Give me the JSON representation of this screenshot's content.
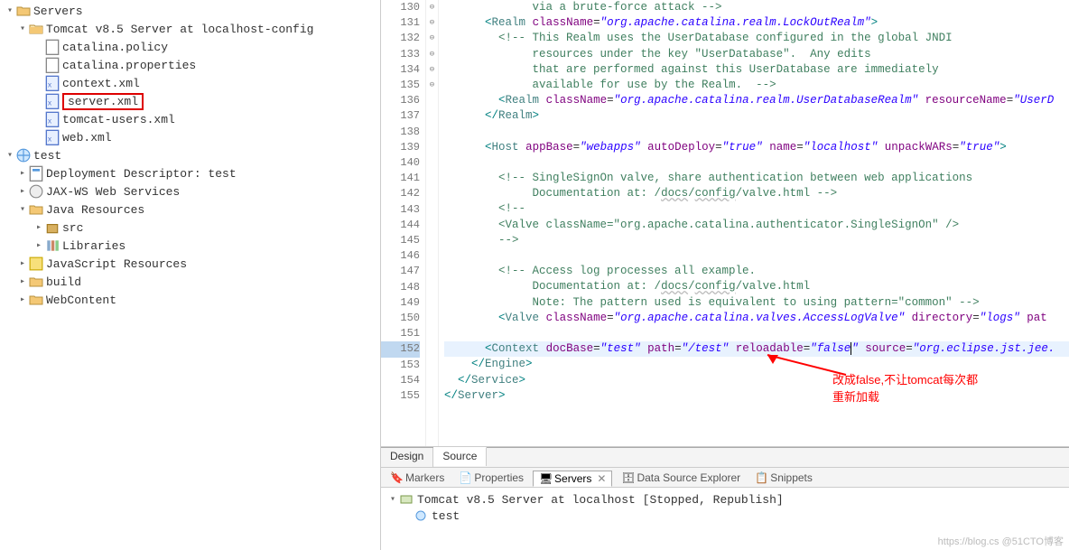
{
  "tree": {
    "servers": "Servers",
    "tomcat_config": "Tomcat v8.5 Server at localhost-config",
    "catalina_policy": "catalina.policy",
    "catalina_properties": "catalina.properties",
    "context_xml": "context.xml",
    "server_xml": "server.xml",
    "tomcat_users_xml": "tomcat-users.xml",
    "web_xml": "web.xml",
    "test": "test",
    "deployment_descriptor": "Deployment Descriptor: test",
    "jaxws": "JAX-WS Web Services",
    "java_resources": "Java Resources",
    "src": "src",
    "libraries": "Libraries",
    "js_resources": "JavaScript Resources",
    "build": "build",
    "webcontent": "WebContent"
  },
  "code": {
    "lines": [
      {
        "n": 130,
        "fold": "",
        "html": "             via a brute-force attack --&gt;",
        "cls": "c-comment"
      },
      {
        "n": 131,
        "fold": "⊖",
        "html": "      <span class='c-punct'>&lt;</span><span class='c-tag'>Realm</span> <span class='c-attr'>className</span>=<span class='c-val-str'>\"org.apache.catalina.realm.LockOutRealm\"</span><span class='c-punct'>&gt;</span>"
      },
      {
        "n": 132,
        "fold": "⊖",
        "html": "        <span class='c-comment'>&lt;!-- This Realm uses the UserDatabase configured in the global JNDI</span>"
      },
      {
        "n": 133,
        "fold": "",
        "html": "             <span class='c-comment'>resources under the key \"UserDatabase\".  Any edits</span>"
      },
      {
        "n": 134,
        "fold": "",
        "html": "             <span class='c-comment'>that are performed against this UserDatabase are immediately</span>"
      },
      {
        "n": 135,
        "fold": "",
        "html": "             <span class='c-comment'>available for use by the Realm.  --&gt;</span>"
      },
      {
        "n": 136,
        "fold": "",
        "html": "        <span class='c-punct'>&lt;</span><span class='c-tag'>Realm</span> <span class='c-attr'>className</span>=<span class='c-val-str'>\"org.apache.catalina.realm.UserDatabaseRealm\"</span> <span class='c-attr'>resourceName</span>=<span class='c-val-str'>\"UserD</span>"
      },
      {
        "n": 137,
        "fold": "",
        "html": "      <span class='c-punct'>&lt;/</span><span class='c-tag'>Realm</span><span class='c-punct'>&gt;</span>"
      },
      {
        "n": 138,
        "fold": "",
        "html": ""
      },
      {
        "n": 139,
        "fold": "⊖",
        "html": "      <span class='c-punct'>&lt;</span><span class='c-tag'>Host</span> <span class='c-attr'>appBase</span>=<span class='c-val-str'>\"webapps\"</span> <span class='c-attr'>autoDeploy</span>=<span class='c-val-str'>\"true\"</span> <span class='c-attr'>name</span>=<span class='c-val-str'>\"localhost\"</span> <span class='c-attr'>unpackWARs</span>=<span class='c-val-str'>\"true\"</span><span class='c-punct'>&gt;</span>"
      },
      {
        "n": 140,
        "fold": "",
        "html": ""
      },
      {
        "n": 141,
        "fold": "⊖",
        "html": "        <span class='c-comment'>&lt;!-- SingleSignOn valve, share authentication between web applications</span>"
      },
      {
        "n": 142,
        "fold": "",
        "html": "             <span class='c-comment'>Documentation at: /<span class='underline-wave'>docs</span>/<span class='underline-wave'>config</span>/valve.html --&gt;</span>"
      },
      {
        "n": 143,
        "fold": "⊖",
        "html": "        <span class='c-comment'>&lt;!--</span>"
      },
      {
        "n": 144,
        "fold": "",
        "html": "        <span class='c-comment'>&lt;Valve className=\"org.apache.catalina.authenticator.SingleSignOn\" /&gt;</span>"
      },
      {
        "n": 145,
        "fold": "",
        "html": "        <span class='c-comment'>--&gt;</span>"
      },
      {
        "n": 146,
        "fold": "",
        "html": ""
      },
      {
        "n": 147,
        "fold": "⊖",
        "html": "        <span class='c-comment'>&lt;!-- Access log processes all example.</span>"
      },
      {
        "n": 148,
        "fold": "",
        "html": "             <span class='c-comment'>Documentation at: /<span class='underline-wave'>docs</span>/<span class='underline-wave'>config</span>/valve.html</span>"
      },
      {
        "n": 149,
        "fold": "",
        "html": "             <span class='c-comment'>Note: The pattern used is equivalent to using pattern=\"common\" --&gt;</span>"
      },
      {
        "n": 150,
        "fold": "",
        "html": "        <span class='c-punct'>&lt;</span><span class='c-tag'>Valve</span> <span class='c-attr'>className</span>=<span class='c-val-str'>\"org.apache.catalina.valves.AccessLogValve\"</span> <span class='c-attr'>directory</span>=<span class='c-val-str'>\"logs\"</span> <span class='c-attr'>pat</span>"
      },
      {
        "n": 151,
        "fold": "",
        "html": ""
      },
      {
        "n": 152,
        "fold": "",
        "hl": true,
        "html": "      <span class='c-punct'>&lt;</span><span class='c-tag'>Context</span> <span class='c-attr'>docBase</span>=<span class='c-val-str'>\"test\"</span> <span class='c-attr'>path</span>=<span class='c-val-str'>\"/test\"</span> <span class='c-attr'>reloadable</span>=<span class='c-val-str'>\"false<span style='border-left:1px solid #000'></span>\"</span> <span class='c-attr'>source</span>=<span class='c-val-str'>\"org.eclipse.jst.jee.</span>"
      },
      {
        "n": 153,
        "fold": "",
        "html": "    <span class='c-punct'>&lt;/</span><span class='c-tag'>Engine</span><span class='c-punct'>&gt;</span>"
      },
      {
        "n": 154,
        "fold": "",
        "html": "  <span class='c-punct'>&lt;/</span><span class='c-tag'>Service</span><span class='c-punct'>&gt;</span>"
      },
      {
        "n": 155,
        "fold": "",
        "html": "<span class='c-punct'>&lt;/</span><span class='c-tag'>Server</span><span class='c-punct'>&gt;</span>"
      }
    ]
  },
  "tabs": {
    "design": "Design",
    "source": "Source"
  },
  "views": {
    "markers": "Markers",
    "properties": "Properties",
    "servers": "Servers",
    "data_source": "Data Source Explorer",
    "snippets": "Snippets"
  },
  "servers_panel": {
    "server_line": "Tomcat v8.5 Server at localhost  [Stopped, Republish]",
    "module": "test"
  },
  "annotation": {
    "line1": "改成false,不让tomcat每次都",
    "line2": "重新加载"
  },
  "watermark": "https://blog.cs  @51CTO博客"
}
